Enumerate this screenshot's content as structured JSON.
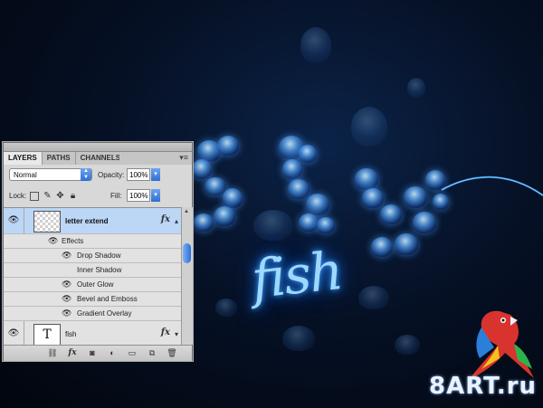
{
  "panel": {
    "tabs": [
      {
        "label": "LAYERS",
        "active": true
      },
      {
        "label": "PATHS",
        "active": false
      },
      {
        "label": "CHANNELS",
        "active": false
      }
    ],
    "menu_icon": "panel-menu-icon",
    "blend_mode": "Normal",
    "opacity_label": "Opacity:",
    "opacity_value": "100%",
    "lock_label": "Lock:",
    "fill_label": "Fill:",
    "fill_value": "100%",
    "layers": [
      {
        "name": "letter extend",
        "selected": true,
        "thumbnail": "transparent",
        "fx": "fx",
        "effects_label": "Effects",
        "effects": [
          {
            "name": "Drop Shadow",
            "visible": true
          },
          {
            "name": "Inner Shadow",
            "visible": false
          },
          {
            "name": "Outer Glow",
            "visible": true
          },
          {
            "name": "Bevel and Emboss",
            "visible": true
          },
          {
            "name": "Gradient Overlay",
            "visible": true
          }
        ]
      },
      {
        "name": "fish",
        "selected": false,
        "thumbnail_text": "T",
        "fx": "fx"
      }
    ]
  },
  "canvas": {
    "art_text": "fish",
    "watermark": "8ART.ru",
    "accent_color": "#3aa0ff"
  }
}
